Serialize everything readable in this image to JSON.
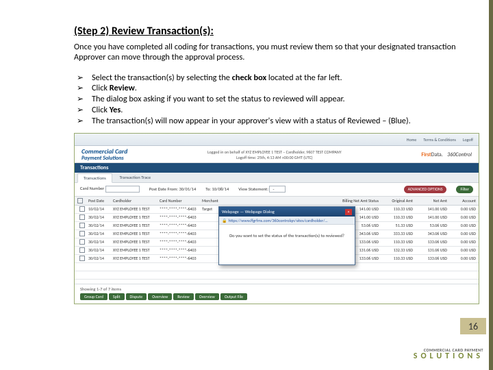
{
  "title": "(Step 2) Review Transaction(s):",
  "intro": "Once you have completed all coding for transactions, you must review them so that your designated transaction Approver can move through the approval process.",
  "steps": [
    {
      "pre": "Select the transaction(s) by selecting the ",
      "bold": "check box",
      "post": " located at the far left."
    },
    {
      "pre": "Click ",
      "bold": "Review",
      "post": "."
    },
    {
      "pre": "The dialog box asking if you want to set the status to reviewed will appear.",
      "bold": "",
      "post": ""
    },
    {
      "pre": "Click ",
      "bold": "Yes",
      "post": "."
    },
    {
      "pre": "The transaction(s) will now appear in your approver's view with a status of    Reviewed – (Blue).",
      "bold": "",
      "post": ""
    }
  ],
  "page_number": "16",
  "footer": {
    "l1": "COMMERCIAL CARD PAYMENT",
    "l2": "SOLUTIONS"
  },
  "shot": {
    "top_links": [
      "Home",
      "Terms & Conditions",
      "Logoff"
    ],
    "brand": {
      "l1": "Commercial Card",
      "l2": "Payment Solutions"
    },
    "login": "Logged in on behalf of XYZ EMPLOYEE 1 TEST – Cardholder, 9607 TEST COMPANY",
    "login2": "Logoff time: 25th, 4:13 AM +00:00 GMT (UTC)",
    "firstdata": "FirstData.",
    "ctrl": "360Control",
    "section": "Transactions",
    "tabs": [
      "Transactions",
      "Transaction Trace"
    ],
    "filter": {
      "cardlbl": "Card Number",
      "postlbl": "Post Date From: 30/01/14",
      "tolbl": "To: 10/08/14",
      "viewlbl": "View Statement:",
      "opt": "-",
      "adv": "ADVANCED OPTIONS",
      "btn": "Filter"
    },
    "cols": [
      "",
      "Post Date",
      "Cardholder",
      "Card Number",
      "Merchant",
      "Billing Net Amt Status",
      "Original Amt",
      "Net Amt",
      "Account"
    ],
    "rows": [
      {
        "d": "10/02/14",
        "c": "XYZ EMPLOYEE 1 TEST",
        "n": "****-****-****-6403",
        "m": "Target",
        "na": "141.00 USD",
        "oa": "110.33 USD",
        "ac": "0.00 USD"
      },
      {
        "d": "30/02/14",
        "c": "XYZ EMPLOYEE 1 TEST",
        "n": "****-****-****-6403",
        "m": "",
        "na": "141.00 USD",
        "oa": "110.33 USD",
        "ac": "0.00 USD"
      },
      {
        "d": "30/02/14",
        "c": "XYZ EMPLOYEE 1 TEST",
        "n": "****-****-****-6403",
        "m": "",
        "na": "53.06 USD",
        "oa": "51.33 USD",
        "ac": "0.00 USD"
      },
      {
        "d": "30/02/14",
        "c": "XYZ EMPLOYEE 1 TEST",
        "n": "****-****-****-6403",
        "m": "",
        "na": "343.06 USD",
        "oa": "333.33 USD",
        "ac": "0.00 USD"
      },
      {
        "d": "30/02/14",
        "c": "XYZ EMPLOYEE 1 TEST",
        "n": "****-****-****-6403",
        "m": "",
        "na": "133.06 USD",
        "oa": "110.33 USD",
        "ac": "0.00 USD"
      },
      {
        "d": "30/02/14",
        "c": "XYZ EMPLOYEE 1 TEST",
        "n": "****-****-****-6403",
        "m": "",
        "na": "131.06 USD",
        "oa": "132.33 USD",
        "ac": "0.00 USD"
      },
      {
        "d": "30/02/14",
        "c": "XYZ EMPLOYEE 1 TEST",
        "n": "****-****-****-6403",
        "m": "",
        "na": "133.06 USD",
        "oa": "110.33 USD",
        "ac": "0.00 USD"
      }
    ],
    "dialog": {
      "title": "Webpage — Webpage Dialog",
      "url": "https://www.ffgrfms.com/360controlqn/sites/cardholder/…",
      "msg": "Do you want to set the status of the transaction(s) to reviewed?"
    },
    "pager": "Showing 1-7 of 7 items",
    "btns": [
      "Group Card",
      "Split",
      "Dispute",
      "Overview",
      "Review",
      "Overview",
      "Output File"
    ]
  }
}
